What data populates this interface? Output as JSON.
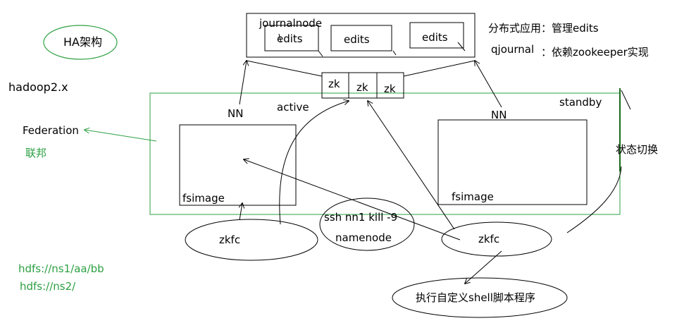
{
  "labels": {
    "ha_architecture": "HA架构",
    "hadoop_version": "hadoop2.x",
    "federation": "Federation",
    "federation_cn": "联邦",
    "journalnode": "journalnode",
    "edits": "edits",
    "distributed_app": "分布式应用：管理edits",
    "qjournal": "qjournal",
    "qjournal_desc": "：依赖zookeeper实现",
    "zk": "zk",
    "nn": "NN",
    "active": "active",
    "standby": "standby",
    "fsimage": "fsimage",
    "state_switch": "状态切换",
    "zkfc": "zkfc",
    "ssh_kill": "ssh nn1 kill -9",
    "namenode": "namenode",
    "custom_shell": "执行自定义shell脚本程序",
    "hdfs_ns1": "hdfs://ns1/aa/bb",
    "hdfs_ns2": "hdfs://ns2/"
  },
  "colors": {
    "green": "#2ea043",
    "ink": "#000000",
    "dark_green": "#1a6b1a"
  }
}
